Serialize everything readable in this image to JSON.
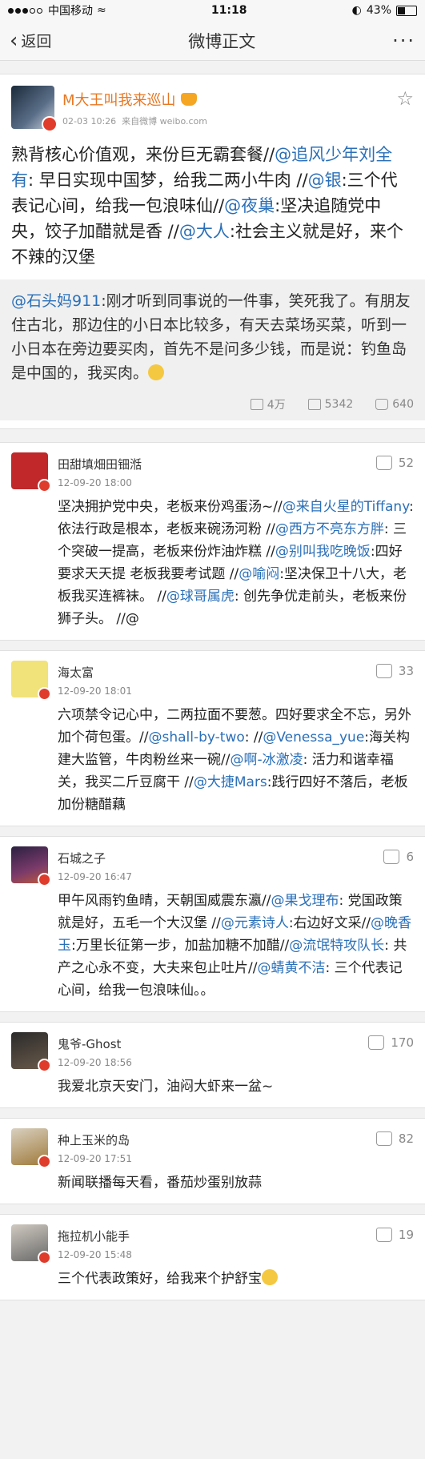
{
  "status_bar": {
    "carrier": "中国移动",
    "time": "11:18",
    "battery": "43%",
    "battery_level": 0.43
  },
  "nav": {
    "back_label": "返回",
    "title": "微博正文",
    "more_label": "···"
  },
  "post": {
    "author": "M大王叫我来巡山",
    "date": "02-03 10:26",
    "source": "来自微博 weibo.com",
    "text_segments": [
      {
        "t": "熟背核心价值观，来份巨无霸套餐//",
        "m": false
      },
      {
        "t": "@追风少年刘全有",
        "m": true
      },
      {
        "t": ": 早日实现中国梦，给我二两小牛肉 //",
        "m": false
      },
      {
        "t": "@银",
        "m": true
      },
      {
        "t": ":三个代表记心间，给我一包浪味仙//",
        "m": false
      },
      {
        "t": "@夜巢",
        "m": true
      },
      {
        "t": ":坚决追随党中央，饺子加醋就是香 //",
        "m": false
      },
      {
        "t": "@大人",
        "m": true
      },
      {
        "t": ":社会主义就是好，来个不辣的汉堡",
        "m": false
      }
    ],
    "repost": {
      "segments": [
        {
          "t": "@石头妈911",
          "m": true
        },
        {
          "t": ":刚才听到同事说的一件事，笑死我了。有朋友住古北，那边住的小日本比较多，有天去菜场买菜，听到一小日本在旁边要买肉，首先不是问多少钱，而是说：钓鱼岛是中国的，我买肉。",
          "m": false
        }
      ],
      "stats": {
        "reposts": "4万",
        "comments": "5342",
        "likes": "640"
      }
    }
  },
  "comments": [
    {
      "name": "田甜填畑田钿湉",
      "time": "12-09-20 18:00",
      "likes": "52",
      "segments": [
        {
          "t": "坚决拥护党中央，老板来份鸡蛋汤~//",
          "m": false
        },
        {
          "t": "@来自火星的Tiffany",
          "m": true
        },
        {
          "t": ":依法行政是根本，老板来碗汤河粉 //",
          "m": false
        },
        {
          "t": "@西方不亮东方胖",
          "m": true
        },
        {
          "t": ": 三个突破一提高，老板来份炸油炸糕 //",
          "m": false
        },
        {
          "t": "@别叫我吃晚饭",
          "m": true
        },
        {
          "t": ":四好要求天天提 老板我要考试题 //",
          "m": false
        },
        {
          "t": "@喻闷",
          "m": true
        },
        {
          "t": ":坚决保卫十八大，老板我买连裤袜。 ",
          "m": false
        },
        {
          "t": "//",
          "m": false
        },
        {
          "t": "@球哥属虎",
          "m": true
        },
        {
          "t": ": 创先争优走前头，老板来份狮子头。 //@",
          "m": false
        }
      ]
    },
    {
      "name": "海太富",
      "time": "12-09-20 18:01",
      "likes": "33",
      "segments": [
        {
          "t": "六项禁令记心中，二两拉面不要葱。四好要求全不忘，另外加个荷包蛋。//",
          "m": false
        },
        {
          "t": "@shall-by-two",
          "m": true
        },
        {
          "t": ": //",
          "m": false
        },
        {
          "t": "@Venessa_yue",
          "m": true
        },
        {
          "t": ":海关构建大监管，牛肉粉丝来一碗//",
          "m": false
        },
        {
          "t": "@啊-冰激凌",
          "m": true
        },
        {
          "t": ": 活力和谐幸福关，我买二斤豆腐干 //",
          "m": false
        },
        {
          "t": "@大捷Mars",
          "m": true
        },
        {
          "t": ":践行四好不落后，老板加份糖醋藕",
          "m": false
        }
      ]
    },
    {
      "name": "石城之子",
      "time": "12-09-20 16:47",
      "likes": "6",
      "segments": [
        {
          "t": "甲午风雨钓鱼晴，天朝国威震东瀛//",
          "m": false
        },
        {
          "t": "@果戈理布",
          "m": true
        },
        {
          "t": ": 党国政策就是好，五毛一个大汉堡 //",
          "m": false
        },
        {
          "t": "@元素诗人",
          "m": true
        },
        {
          "t": ":右边好文采//",
          "m": false
        },
        {
          "t": "@晚香玉",
          "m": true
        },
        {
          "t": ":万里长征第一步，加盐加糖不加醋//",
          "m": false
        },
        {
          "t": "@流氓特攻队长",
          "m": true
        },
        {
          "t": ": 共产之心永不变，大夫来包止吐片//",
          "m": false
        },
        {
          "t": "@蜻黄不洁",
          "m": true
        },
        {
          "t": ": 三个代表记心间，给我一包浪味仙。。",
          "m": false
        }
      ]
    },
    {
      "name": "鬼爷-Ghost",
      "time": "12-09-20 18:56",
      "likes": "170",
      "segments": [
        {
          "t": "我爱北京天安门，油闷大虾来一盆~",
          "m": false
        }
      ]
    },
    {
      "name": "种上玉米的岛",
      "time": "12-09-20 17:51",
      "likes": "82",
      "segments": [
        {
          "t": "新闻联播每天看，番茄炒蛋别放蒜",
          "m": false
        }
      ]
    },
    {
      "name": "拖拉机小能手",
      "time": "12-09-20 15:48",
      "likes": "19",
      "segments": [
        {
          "t": "三个代表政策好，给我来个护舒宝",
          "m": false
        }
      ]
    }
  ]
}
